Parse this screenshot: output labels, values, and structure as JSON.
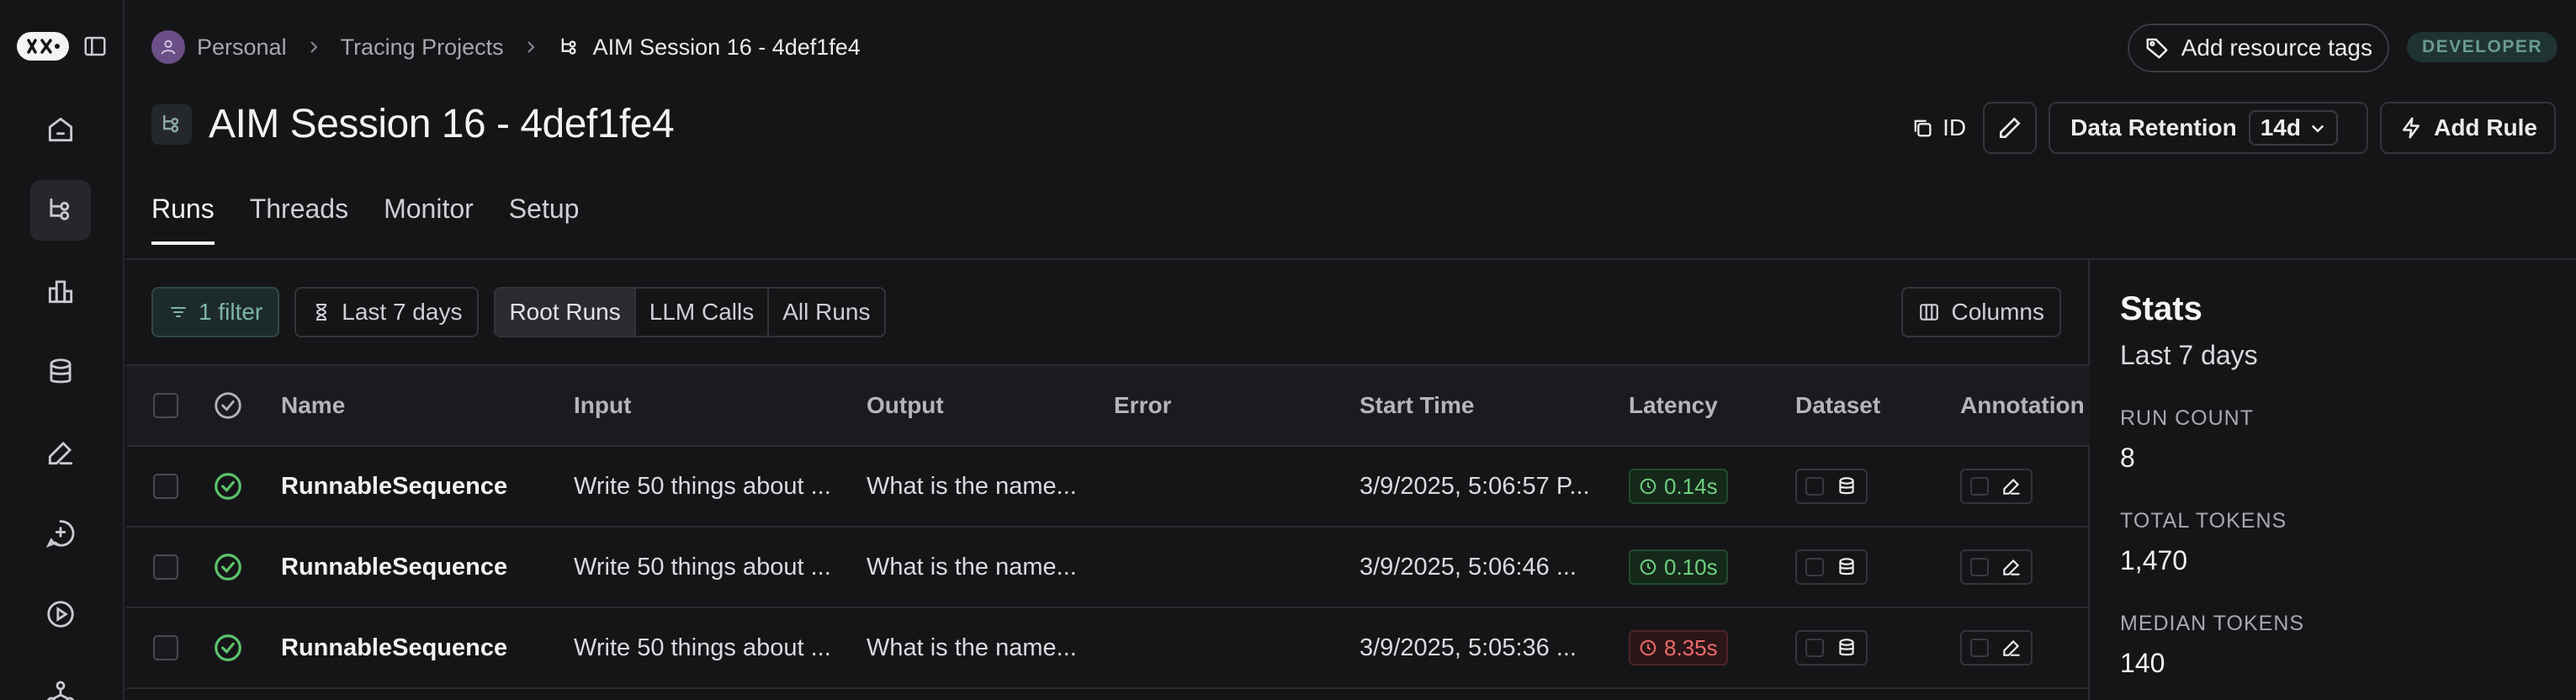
{
  "breadcrumb": {
    "workspace": "Personal",
    "section": "Tracing Projects",
    "current": "AIM Session 16 - 4def1fe4"
  },
  "header": {
    "tags_button": "Add resource tags",
    "badge": "DEVELOPER",
    "title": "AIM Session 16 - 4def1fe4",
    "id_label": "ID",
    "retention_label": "Data Retention",
    "retention_value": "14d",
    "add_rule": "Add Rule"
  },
  "tabs": [
    "Runs",
    "Threads",
    "Monitor",
    "Setup"
  ],
  "toolbar": {
    "filter": "1 filter",
    "range": "Last 7 days",
    "run_types": [
      "Root Runs",
      "LLM Calls",
      "All Runs"
    ],
    "columns": "Columns"
  },
  "table": {
    "headers": {
      "name": "Name",
      "input": "Input",
      "output": "Output",
      "error": "Error",
      "start_time": "Start Time",
      "latency": "Latency",
      "dataset": "Dataset",
      "annotation": "Annotation"
    },
    "rows": [
      {
        "name": "RunnableSequence",
        "input": "Write 50 things about ...",
        "output": "What is the name...",
        "error": "",
        "start_time": "3/9/2025, 5:06:57 P...",
        "latency": "0.14s",
        "latency_status": "ok"
      },
      {
        "name": "RunnableSequence",
        "input": "Write 50 things about ...",
        "output": "What is the name...",
        "error": "",
        "start_time": "3/9/2025, 5:06:46 ...",
        "latency": "0.10s",
        "latency_status": "ok"
      },
      {
        "name": "RunnableSequence",
        "input": "Write 50 things about ...",
        "output": "What is the name...",
        "error": "",
        "start_time": "3/9/2025, 5:05:36 ...",
        "latency": "8.35s",
        "latency_status": "slow"
      }
    ]
  },
  "stats": {
    "title": "Stats",
    "range": "Last 7 days",
    "items": [
      {
        "label": "RUN COUNT",
        "value": "8"
      },
      {
        "label": "TOTAL TOKENS",
        "value": "1,470"
      },
      {
        "label": "MEDIAN TOKENS",
        "value": "140"
      }
    ]
  },
  "colors": {
    "background": "#151518",
    "accent_teal": "#7fb3ab",
    "success": "#6fcf7f",
    "danger": "#ef6b6b"
  },
  "icons": {
    "rail": [
      "home-icon",
      "tracing-icon",
      "dashboard-icon",
      "datasets-icon",
      "annotation-icon",
      "prompts-icon",
      "playground-icon",
      "deployments-icon"
    ]
  }
}
